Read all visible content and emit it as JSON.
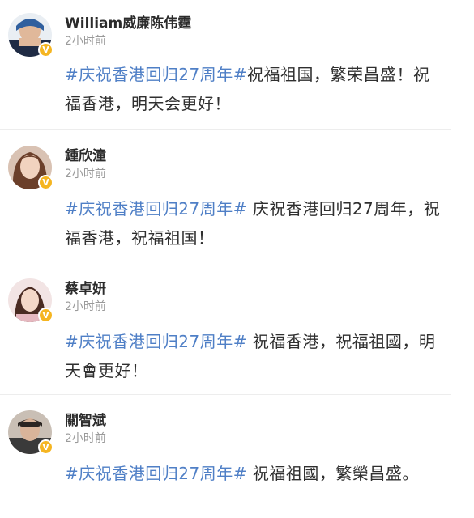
{
  "posts": [
    {
      "name": "William威廉陈伟霆",
      "time": "2小时前",
      "hashtag": "#庆祝香港回归27周年#",
      "text": "祝福祖国，繁荣昌盛！祝福香港，明天会更好！",
      "verified_badge": "V"
    },
    {
      "name": "鍾欣潼",
      "time": "2小时前",
      "hashtag": "#庆祝香港回归27周年#",
      "text": " 庆祝香港回归27周年，祝福香港，祝福祖国！",
      "verified_badge": "V"
    },
    {
      "name": "蔡卓妍",
      "time": "2小时前",
      "hashtag": "#庆祝香港回归27周年#",
      "text": " 祝福香港，祝福祖國，明天會更好！",
      "verified_badge": "V"
    },
    {
      "name": "關智斌",
      "time": "2小时前",
      "hashtag": "#庆祝香港回归27周年#",
      "text": " 祝福祖國，繁榮昌盛。",
      "verified_badge": "V"
    }
  ],
  "colors": {
    "hashtag": "#4f7fc6",
    "name": "#2b2b2b",
    "time": "#9a9a9a",
    "verified": "#f5b521",
    "divider": "#ededed"
  }
}
